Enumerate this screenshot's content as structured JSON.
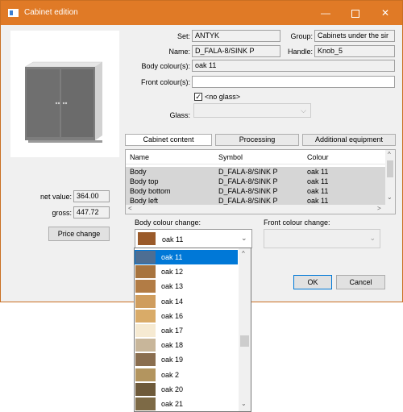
{
  "window": {
    "title": "Cabinet edition",
    "minimize": "—",
    "close": "✕"
  },
  "form": {
    "set_label": "Set:",
    "set_value": "ANTYK",
    "group_label": "Group:",
    "group_value": "Cabinets under the sir",
    "name_label": "Name:",
    "name_value": "D_FALA-8/SINK P",
    "handle_label": "Handle:",
    "handle_value": "Knob_5",
    "body_colour_label": "Body colour(s):",
    "body_colour_value": "oak 11",
    "front_colour_label": "Front colour(s):",
    "front_colour_value": "",
    "no_glass_label": "<no glass>",
    "no_glass_checked": true,
    "checkmark": "✓",
    "glass_label": "Glass:",
    "glass_arrow": "⌵"
  },
  "tabs": [
    "Cabinet content",
    "Processing",
    "Additional equipment"
  ],
  "grid": {
    "columns": [
      "Name",
      "Symbol",
      "Colour"
    ],
    "rows": [
      {
        "name": "Body",
        "symbol": "D_FALA-8/SINK P",
        "colour": "oak 11"
      },
      {
        "name": "Body top",
        "symbol": "D_FALA-8/SINK P",
        "colour": "oak 11"
      },
      {
        "name": "Body bottom",
        "symbol": "D_FALA-8/SINK P",
        "colour": "oak 11"
      },
      {
        "name": "Body left",
        "symbol": "D_FALA-8/SINK P",
        "colour": "oak 11"
      }
    ],
    "scroll_up": "^",
    "scroll_down": "⌄",
    "scroll_left": "<",
    "scroll_right": ">"
  },
  "price": {
    "net_label": "net value:",
    "net_value": "364.00",
    "gross_label": "gross:",
    "gross_value": "447.72",
    "button": "Price change"
  },
  "colour_change": {
    "body_label": "Body colour change:",
    "body_value": "oak 11",
    "body_arrow": "⌄",
    "front_label": "Front colour change:",
    "front_arrow": "⌄"
  },
  "buttons": {
    "ok": "OK",
    "cancel": "Cancel"
  },
  "dropdown": {
    "items": [
      {
        "label": "oak 11",
        "color": "#4d6e93"
      },
      {
        "label": "oak 12",
        "color": "#a8743e"
      },
      {
        "label": "oak 13",
        "color": "#b27c45"
      },
      {
        "label": "oak 14",
        "color": "#cf9d5e"
      },
      {
        "label": "oak 16",
        "color": "#d9ab68"
      },
      {
        "label": "oak 17",
        "color": "#f6ead2"
      },
      {
        "label": "oak 18",
        "color": "#c8b69a"
      },
      {
        "label": "oak 19",
        "color": "#8a6e4f"
      },
      {
        "label": "oak 2",
        "color": "#b3955f"
      },
      {
        "label": "oak 20",
        "color": "#6e5a3a"
      },
      {
        "label": "oak 21",
        "color": "#7d6a46"
      }
    ],
    "selected_index": 0,
    "scroll_up": "^",
    "scroll_down": "⌄"
  },
  "colors": {
    "accent": "#e07a26",
    "selection": "#0078d7",
    "body_swatch": "#9a5a2a"
  }
}
